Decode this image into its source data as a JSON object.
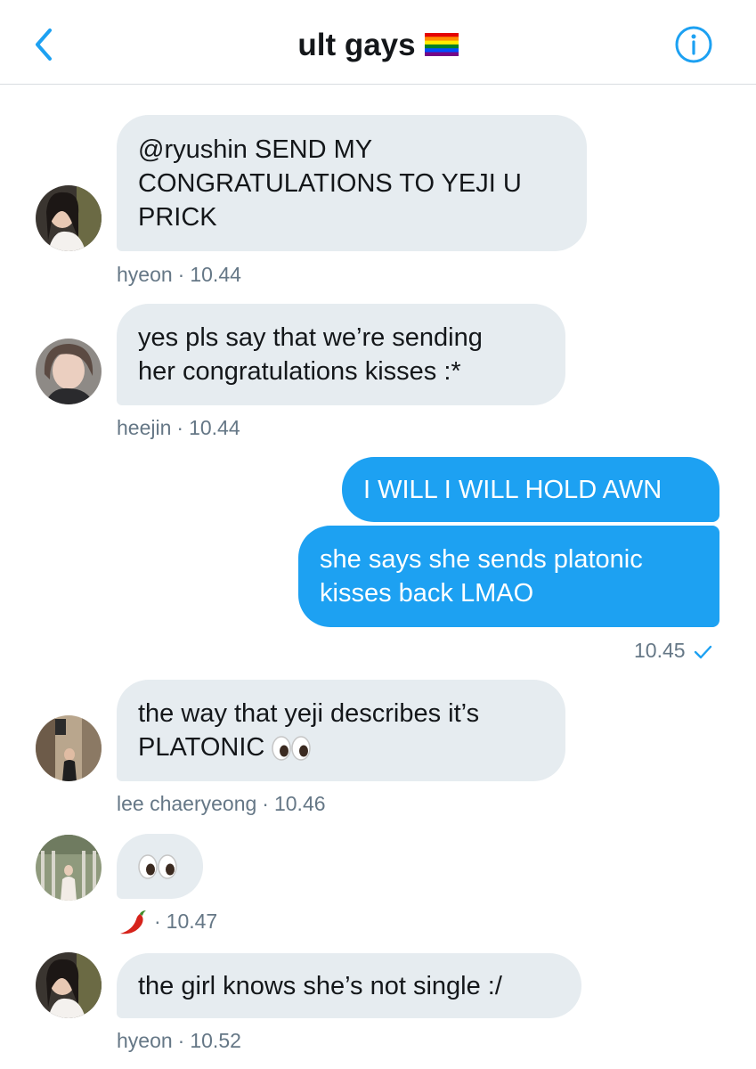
{
  "header": {
    "title": "ult gays",
    "flag_icon": "rainbow-flag-icon",
    "back_icon": "chevron-left-icon",
    "info_icon": "info-icon",
    "accent": "#1da1f2"
  },
  "messages": [
    {
      "sender": "hyeon",
      "time": "10.44",
      "text": "@ryushin SEND MY\nCONGRATULATIONS TO YEJI U\nPRICK"
    },
    {
      "sender": "heejin",
      "time": "10.44",
      "text": "yes pls say that we’re sending\nher congratulations kisses :*"
    },
    {
      "outgoing": true,
      "text": "I WILL I WILL HOLD AWN"
    },
    {
      "outgoing": true,
      "text": "she says she sends platonic\nkisses back LMAO",
      "time": "10.45",
      "status_icon": "checkmark-icon"
    },
    {
      "sender": "lee chaeryeong",
      "time": "10.46",
      "text": "the way that yeji describes it’s\nPLATONIC",
      "emoji": "eyes-emoji-icon"
    },
    {
      "sender_icon": "chili-pepper-icon",
      "time": "10.47",
      "emoji": "eyes-emoji-icon"
    },
    {
      "sender": "hyeon",
      "time": "10.52",
      "text": "the girl knows she’s not single :/"
    }
  ],
  "separator": "·",
  "colors": {
    "incoming_bubble": "#e6ecf0",
    "outgoing_bubble": "#1da1f2",
    "meta_text": "#657786"
  }
}
